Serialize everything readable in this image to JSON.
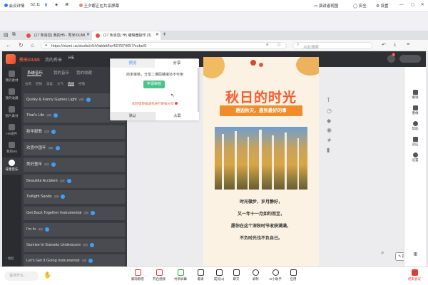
{
  "meeting": {
    "details": "会议详情",
    "timer": "52:11",
    "presenter": "王夕娜正在共享屏幕",
    "annotate": "演讲者视图",
    "security": "安全",
    "settings": "设置"
  },
  "browser": {
    "tabs": [
      "(17 条消息) 我的H5 - 秀米XIUMI",
      "(17 条消息) H5 编辑器操作 (3)"
    ],
    "url": "https://xiumi.us/studio/v5#/tablet/for/597874057/cube/0",
    "search_placeholder": "点此搜索"
  },
  "app": {
    "logo": "秀米XIUMI",
    "breadcrumb": [
      "我的秀米",
      "H5"
    ],
    "notif_count": "4"
  },
  "leftnav": [
    "我的素材",
    "我的收藏",
    "图片素材",
    "H5组件",
    "我的H5",
    "背景音乐"
  ],
  "panel": {
    "tabs": [
      "系统音乐",
      "我的音乐",
      "我的收藏"
    ],
    "filters": [
      "古风",
      "轻快",
      "温柔",
      "大气",
      "情绪",
      "抒情"
    ],
    "songs": [
      "Quirky & Funny Games Light",
      "That's Life",
      "新年献歌",
      "欢喜中国年",
      "美好童年",
      "Beautiful Accident",
      "Twilight Sands",
      "Get Back Together Instrumental",
      "I'm In",
      "Sunrise In Sunsets Underscore",
      "Let's Get It Going Instrumental"
    ],
    "preview_label": "试听",
    "collapse": "收起"
  },
  "popup": {
    "tabs": [
      "预览",
      "分享"
    ],
    "message": "尚未审核，分享二维码链接还不可用",
    "apply_button": "申请审核",
    "warning": "如何得审核请先进行审核分享",
    "modes": [
      "默认",
      "大屏"
    ]
  },
  "poster": {
    "title": "秋日的时光",
    "subtitle": "邂逅秋天，遇到最好的事",
    "lines": [
      "时光微步，岁月静好，",
      "又一年十一月如约而至，",
      "愿你在这个深秋时节收获满满，",
      "不负时光也不负自己。"
    ]
  },
  "rightbar": [
    "撤销",
    "重做",
    "帮助",
    "适应",
    "设置"
  ],
  "canvas_actions": [
    "批注"
  ],
  "bottom": {
    "chat_placeholder": "说点什么...",
    "items": [
      "解除静音",
      "开启视频",
      "共享屏幕",
      "邀请",
      "成员(3)",
      "聊天",
      "录制",
      "AI小助手",
      "应用"
    ],
    "end": "结束会议"
  },
  "colors": {
    "accent": "#ff5a2c",
    "orange": "#f08c2a",
    "green": "#4cc38a",
    "poster_bg": "#fbf2e3"
  }
}
